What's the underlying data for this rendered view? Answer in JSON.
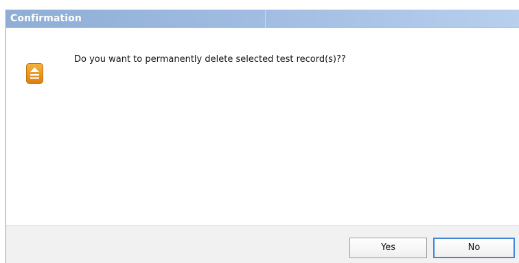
{
  "dialog": {
    "title": "Confirmation",
    "message": "Do you want to permanently delete selected test record(s)??",
    "icon": "warning-icon",
    "buttons": {
      "yes_label": "Yes",
      "no_label": "No"
    }
  },
  "colors": {
    "title_bar": "#9fbbe0",
    "title_text": "#ffffff",
    "icon_orange": "#e8961f",
    "button_focus_border": "#3f86d6",
    "footer_bg": "#f1f1f1"
  }
}
